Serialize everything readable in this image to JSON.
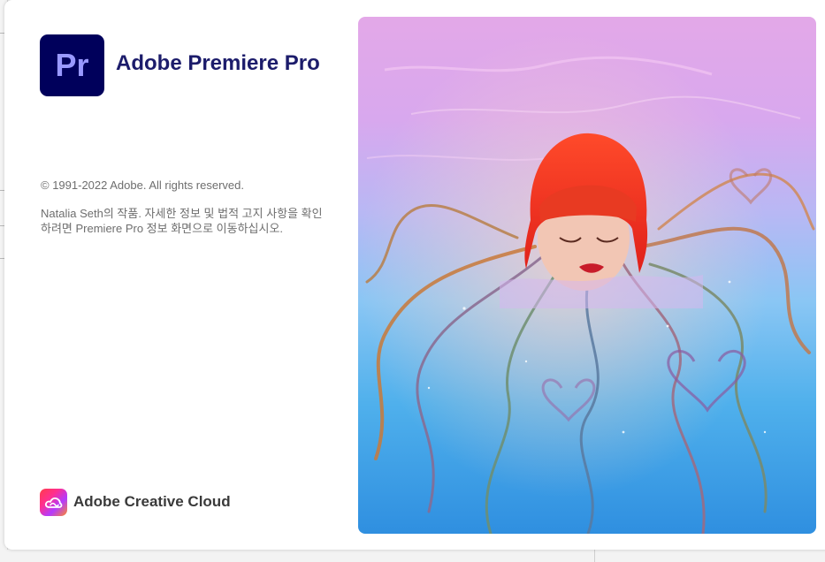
{
  "app": {
    "icon_text": "Pr",
    "title": "Adobe Premiere Pro"
  },
  "legal": {
    "copyright": "© 1991-2022 Adobe. All rights reserved.",
    "credits": "Natalia Seth의 작품. 자세한 정보 및 법적 고지 사항을 확인하려면 Premiere Pro 정보 화면으로 이동하십시오."
  },
  "footer": {
    "brand": "Adobe Creative Cloud"
  },
  "colors": {
    "icon_bg": "#00005b",
    "icon_text": "#9999ff",
    "title": "#1c1c6b",
    "body_text": "#6e6e6e"
  },
  "icons": {
    "app": "premiere-pro-icon",
    "brand": "creative-cloud-icon"
  }
}
